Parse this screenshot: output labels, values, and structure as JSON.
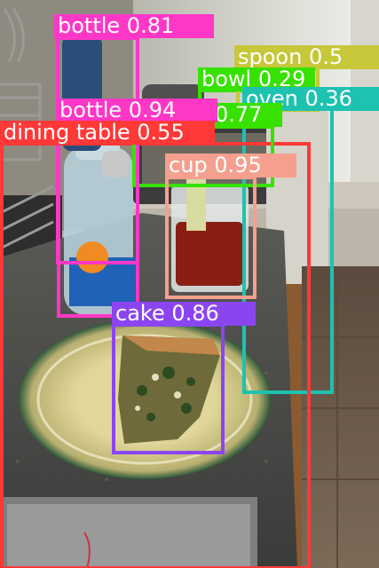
{
  "scene": {
    "description_icon": "kitchen-photo",
    "colors": {
      "window_light": "#e9ece6",
      "wall": "#cfc9bd",
      "counter": "#4a4a48",
      "cabinet": "#3a2a20",
      "floor": "#6a5a4a",
      "plate_rim": "#2f5a3a",
      "plate_center": "#d9cf8a",
      "quiche_crust": "#b57a3a",
      "quiche_fill": "#6b6a3a",
      "juice": "#8a1e12",
      "glass": "#dfe5e3",
      "bottle": "#a9c6d6",
      "bottle_label": "#f08a22",
      "baking_tray": "#8a8a8a"
    }
  },
  "detections": [
    {
      "label": "bottle 0.81",
      "color": "#ff37c7"
    },
    {
      "label": "spoon 0.5",
      "color": "#c7c73a"
    },
    {
      "label": "bowl 0.29",
      "color": "#37e100"
    },
    {
      "label": "oven 0.36",
      "color": "#1ec2b0"
    },
    {
      "label": "bottle 0.94",
      "color": "#ff37c7"
    },
    {
      "label": "0.77",
      "color": "#37e100"
    },
    {
      "label": "dining table 0.55",
      "color": "#ff3838"
    },
    {
      "label": "cup 0.95",
      "color": "#f5a08e"
    },
    {
      "label": "cake 0.86",
      "color": "#8b45f0"
    }
  ]
}
